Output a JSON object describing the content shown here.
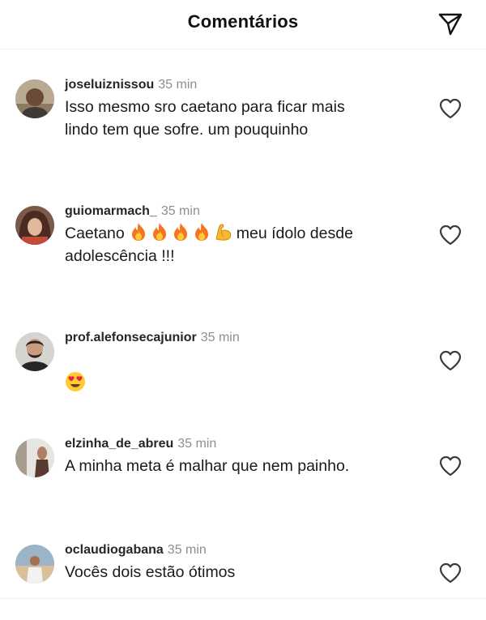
{
  "header": {
    "title": "Comentários",
    "share_icon": "paper-plane-icon"
  },
  "comments": [
    {
      "username": "joseluiznissou",
      "time": "35 min",
      "text": "Isso mesmo sro caetano para ficar mais\nlindo tem que sofre. um pouquinho",
      "like_icon": "heart-outline-icon"
    },
    {
      "username": "guiomarmach_",
      "time": "35 min",
      "text_before": "Caetano",
      "emojis": [
        "fire",
        "fire",
        "fire",
        "fire",
        "flexed-biceps"
      ],
      "text_after": "meu ídolo desde",
      "text_line2": "adolescência !!!",
      "like_icon": "heart-outline-icon"
    },
    {
      "username": "prof.alefonsecajunior",
      "time": "35 min",
      "emoji": "heart-eyes",
      "like_icon": "heart-outline-icon"
    },
    {
      "username": "elzinha_de_abreu",
      "time": "35 min",
      "text": "A minha meta é malhar que nem painho.",
      "like_icon": "heart-outline-icon"
    },
    {
      "username": "oclaudiogabana",
      "time": "35 min",
      "text": "Vocês dois estão ótimos",
      "like_icon": "heart-outline-icon"
    }
  ],
  "colors": {
    "username": "#262626",
    "time": "#8e8e8e",
    "text": "#1a1a1a",
    "divider": "#efefef"
  }
}
